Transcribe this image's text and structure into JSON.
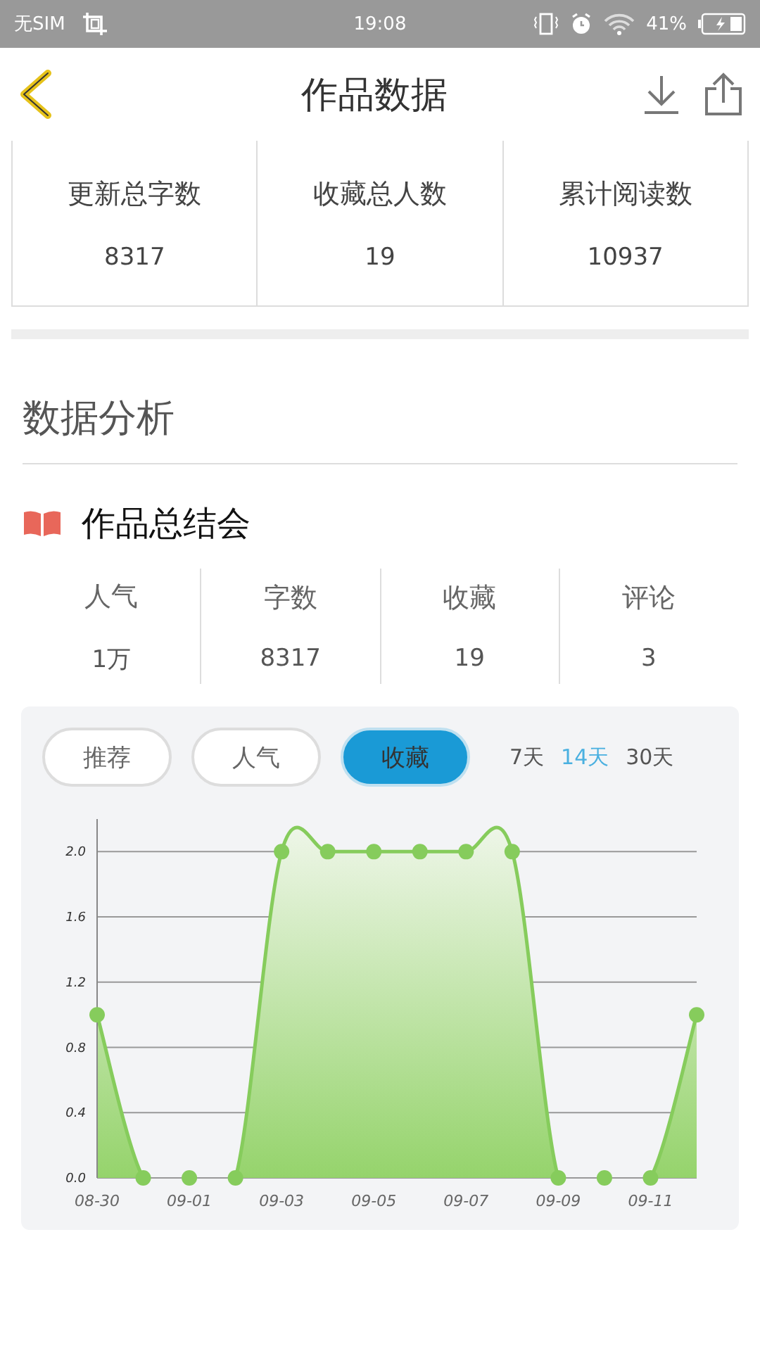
{
  "status_bar": {
    "carrier": "无SIM",
    "time": "19:08",
    "battery": "41%"
  },
  "header": {
    "title": "作品数据"
  },
  "overview": [
    {
      "label": "更新总字数",
      "value": "8317"
    },
    {
      "label": "收藏总人数",
      "value": "19"
    },
    {
      "label": "累计阅读数",
      "value": "10937"
    }
  ],
  "analysis": {
    "title": "数据分析"
  },
  "summary": {
    "title": "作品总结会",
    "stats": [
      {
        "label": "人气",
        "value": "1万"
      },
      {
        "label": "字数",
        "value": "8317"
      },
      {
        "label": "收藏",
        "value": "19"
      },
      {
        "label": "评论",
        "value": "3"
      }
    ]
  },
  "chart_panel": {
    "metric_tabs": [
      {
        "label": "推荐",
        "selected": false
      },
      {
        "label": "人气",
        "selected": false
      },
      {
        "label": "收藏",
        "selected": true
      }
    ],
    "ranges": [
      {
        "label": "7天",
        "selected": false
      },
      {
        "label": "14天",
        "selected": true
      },
      {
        "label": "30天",
        "selected": false
      }
    ],
    "chart_data": {
      "type": "area",
      "categories": [
        "08-30",
        null,
        "09-01",
        null,
        "09-03",
        null,
        "09-05",
        null,
        "09-07",
        null,
        "09-09",
        null,
        "09-11",
        null
      ],
      "series": [
        {
          "color": "#86cc5c",
          "values": [
            1,
            0,
            0,
            0,
            2,
            2,
            2,
            2,
            2,
            2,
            0,
            0,
            0,
            1
          ]
        }
      ],
      "ylim": [
        0,
        2.2
      ],
      "grid": true,
      "yticks": [
        {
          "value": 0,
          "label": "0.0"
        },
        {
          "value": 0.4,
          "label": "0.4"
        },
        {
          "value": 0.8,
          "label": "0.8"
        },
        {
          "value": 1.2,
          "label": "1.2"
        },
        {
          "value": 1.6,
          "label": "1.6"
        },
        {
          "value": 2,
          "label": "2.0"
        }
      ]
    }
  }
}
